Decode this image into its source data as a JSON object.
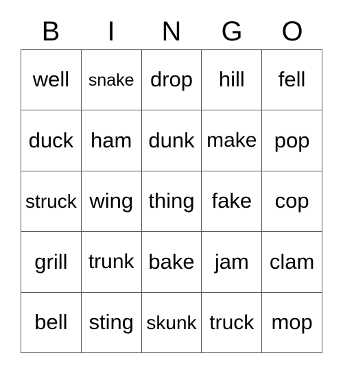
{
  "card": {
    "title": "BINGO",
    "header_letters": [
      "B",
      "I",
      "N",
      "G",
      "O"
    ],
    "grid_size": "5x5",
    "border_color": "#555555",
    "text_color": "#000000",
    "background_color": "#ffffff",
    "rows": [
      [
        {
          "text": "well",
          "size": "full"
        },
        {
          "text": "snake",
          "size": "xs"
        },
        {
          "text": "drop",
          "size": "full"
        },
        {
          "text": "hill",
          "size": "full"
        },
        {
          "text": "fell",
          "size": "full"
        }
      ],
      [
        {
          "text": "duck",
          "size": "full"
        },
        {
          "text": "ham",
          "size": "full"
        },
        {
          "text": "dunk",
          "size": "full"
        },
        {
          "text": "make",
          "size": "m"
        },
        {
          "text": "pop",
          "size": "full"
        }
      ],
      [
        {
          "text": "struck",
          "size": "s"
        },
        {
          "text": "wing",
          "size": "full"
        },
        {
          "text": "thing",
          "size": "full"
        },
        {
          "text": "fake",
          "size": "full"
        },
        {
          "text": "cop",
          "size": "full"
        }
      ],
      [
        {
          "text": "grill",
          "size": "full"
        },
        {
          "text": "trunk",
          "size": "m"
        },
        {
          "text": "bake",
          "size": "full"
        },
        {
          "text": "jam",
          "size": "full"
        },
        {
          "text": "clam",
          "size": "full"
        }
      ],
      [
        {
          "text": "bell",
          "size": "full"
        },
        {
          "text": "sting",
          "size": "full"
        },
        {
          "text": "skunk",
          "size": "s"
        },
        {
          "text": "truck",
          "size": "m"
        },
        {
          "text": "mop",
          "size": "full"
        }
      ]
    ]
  }
}
